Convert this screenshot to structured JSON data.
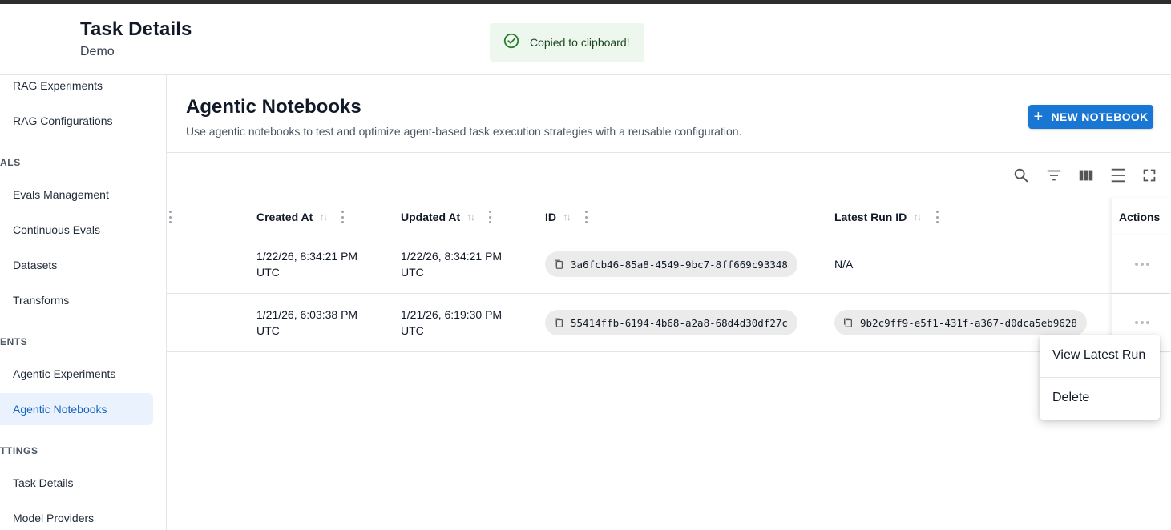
{
  "header": {
    "title": "Task Details",
    "subtitle": "Demo"
  },
  "toast": {
    "message": "Copied to clipboard!",
    "icon": "check-circle-icon",
    "color": "#2e7d32"
  },
  "sidebar": {
    "items": [
      {
        "label": "RAG Experiments",
        "icon": "flask-icon"
      },
      {
        "label": "RAG Configurations",
        "icon": "config-icon"
      },
      {
        "label": "Evals Management",
        "icon": "evals-icon"
      },
      {
        "label": "Continuous Evals",
        "icon": "loop-icon"
      },
      {
        "label": "Datasets",
        "icon": "dataset-icon"
      },
      {
        "label": "Transforms",
        "icon": "transform-icon"
      },
      {
        "label": "Agentic Experiments",
        "icon": "flask-icon"
      },
      {
        "label": "Agentic Notebooks",
        "icon": "notebook-icon",
        "active": true
      },
      {
        "label": "Task Details",
        "icon": "details-icon"
      },
      {
        "label": "Model Providers",
        "icon": "provider-icon"
      }
    ],
    "sections": [
      "ALS",
      "ENTS",
      "TTINGS"
    ]
  },
  "main": {
    "title": "Agentic Notebooks",
    "description": "Use agentic notebooks to test and optimize agent-based task execution strategies with a reusable configuration.",
    "new_button": "NEW NOTEBOOK",
    "accent": "#1976d2"
  },
  "table": {
    "columns": [
      "Created At",
      "Updated At",
      "ID",
      "Latest Run ID",
      "Actions"
    ],
    "rows": [
      {
        "created": [
          "1/22/26, 8:34:21 PM",
          "UTC"
        ],
        "updated": [
          "1/22/26, 8:34:21 PM",
          "UTC"
        ],
        "id": "3a6fcb46-85a8-4549-9bc7-8ff669c93348",
        "latest_run_id": "N/A"
      },
      {
        "created": [
          "1/21/26, 6:03:38 PM",
          "UTC"
        ],
        "updated": [
          "1/21/26, 6:19:30 PM",
          "UTC"
        ],
        "id": "55414ffb-6194-4b68-a2a8-68d4d30df27c",
        "latest_run_id": "9b2c9ff9-e5f1-431f-a367-d0dca5eb9628"
      }
    ]
  },
  "context_menu": {
    "items": [
      "View Latest Run",
      "Delete"
    ]
  }
}
